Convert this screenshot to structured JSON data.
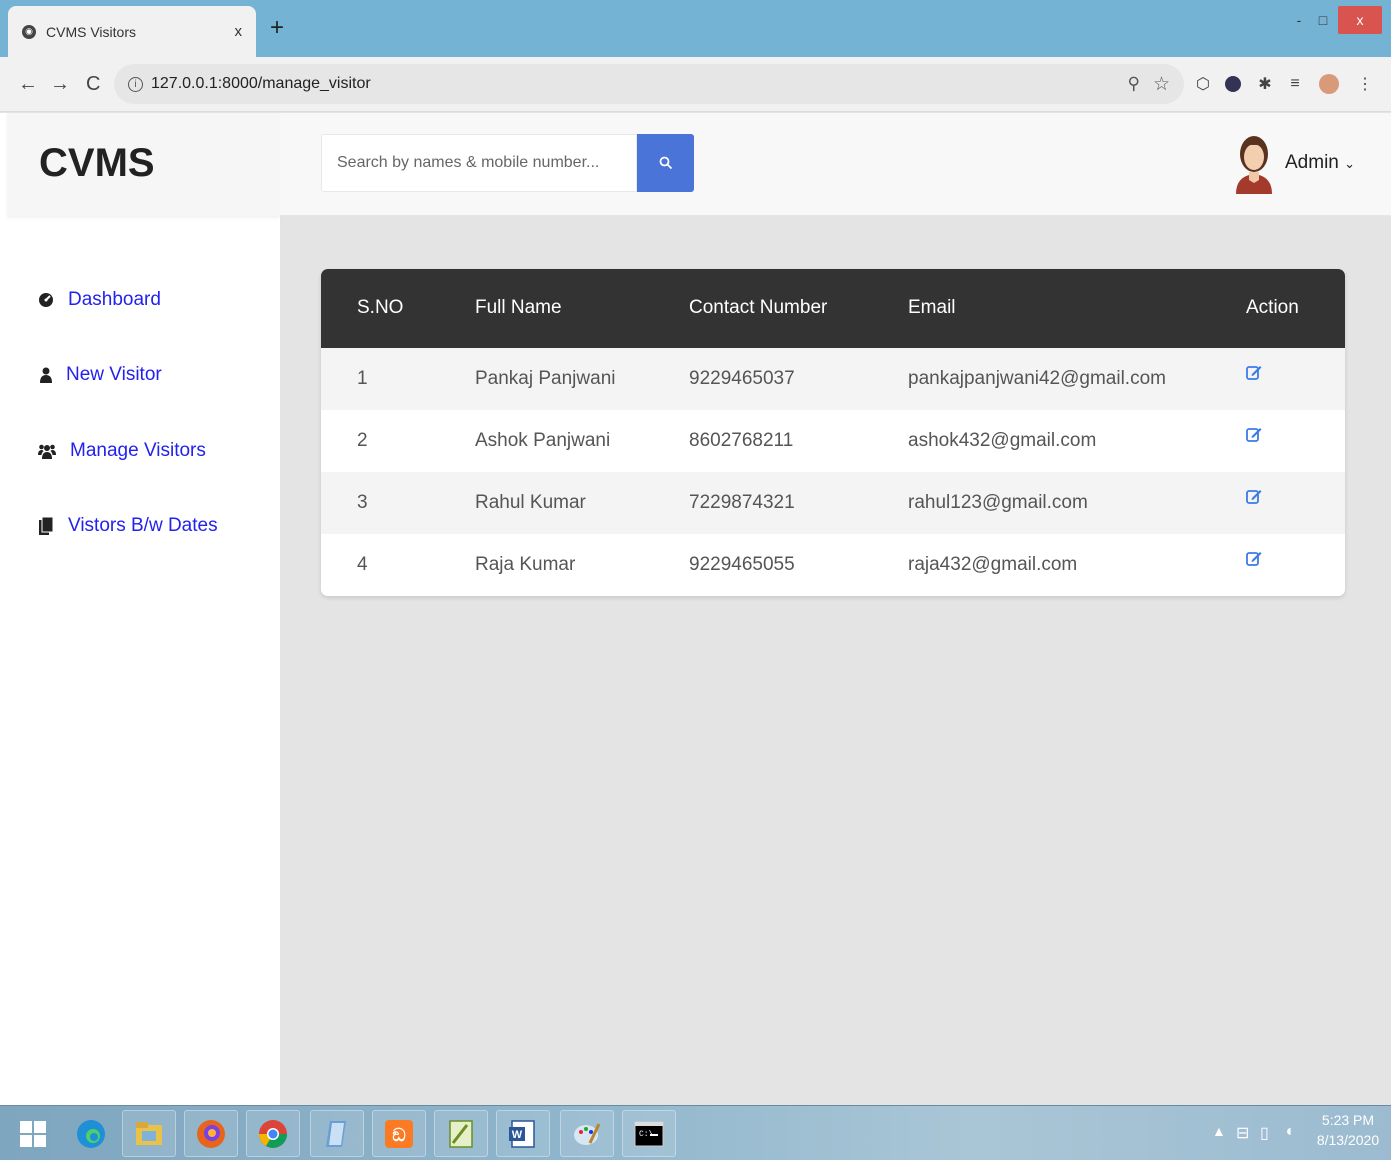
{
  "browser": {
    "tab_title": "CVMS Visitors",
    "tab_close": "x",
    "new_tab": "+",
    "url": "127.0.0.1:8000/manage_visitor",
    "win_min": "-",
    "win_max": "□",
    "win_close": "x"
  },
  "app": {
    "brand": "CVMS",
    "search_placeholder": "Search by names & mobile number...",
    "user_name": "Admin",
    "user_caret": "⌄"
  },
  "sidebar": {
    "items": [
      {
        "label": "Dashboard",
        "icon": "tachometer-icon"
      },
      {
        "label": "New Visitor",
        "icon": "user-icon"
      },
      {
        "label": "Manage Visitors",
        "icon": "users-icon"
      },
      {
        "label": "Vistors B/w Dates",
        "icon": "files-icon"
      }
    ]
  },
  "table": {
    "headers": [
      "S.NO",
      "Full Name",
      "Contact Number",
      "Email",
      "Action"
    ],
    "rows": [
      {
        "sno": "1",
        "name": "Pankaj Panjwani",
        "contact": "9229465037",
        "email": "pankajpanjwani42@gmail.com"
      },
      {
        "sno": "2",
        "name": "Ashok Panjwani",
        "contact": "8602768211",
        "email": "ashok432@gmail.com"
      },
      {
        "sno": "3",
        "name": "Rahul Kumar",
        "contact": "7229874321",
        "email": "rahul123@gmail.com"
      },
      {
        "sno": "4",
        "name": "Raja Kumar",
        "contact": "9229465055",
        "email": "raja432@gmail.com"
      }
    ]
  },
  "taskbar": {
    "time": "5:23 PM",
    "date": "8/13/2020"
  },
  "colors": {
    "accent": "#4a74d8",
    "sidebar_link": "#2222ee",
    "table_header": "#333333",
    "edit_icon": "#3b7be8"
  }
}
